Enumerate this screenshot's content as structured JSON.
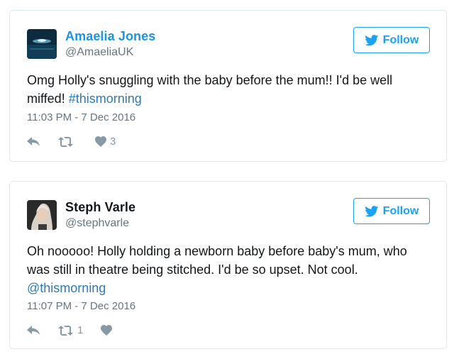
{
  "tweets": [
    {
      "name": "Amaelia Jones",
      "handle": "@AmaeliaUK",
      "follow_label": "Follow",
      "text": "Omg Holly's snuggling with the baby before the mum!! I'd be well miffed! ",
      "hashtag": "#thismorning",
      "timestamp": "11:03 PM - 7 Dec 2016",
      "retweets": "",
      "likes": "3"
    },
    {
      "name": "Steph Varle",
      "handle": "@stephvarle",
      "follow_label": "Follow",
      "text": "Oh nooooo! Holly holding a newborn baby before baby's mum, who was still in theatre being stitched. I'd be so upset. Not cool. ",
      "hashtag": "@thismorning",
      "timestamp": "11:07 PM - 7 Dec 2016",
      "retweets": "1",
      "likes": ""
    }
  ],
  "colors": {
    "accent": "#1da1f2",
    "link": "#2b7bb9",
    "muted": "#66757f",
    "icon": "#8899a6",
    "border": "#e1e8ed"
  },
  "icons": {
    "follow": "twitter-bird-icon",
    "reply": "reply-icon",
    "retweet": "retweet-icon",
    "like": "heart-icon"
  }
}
